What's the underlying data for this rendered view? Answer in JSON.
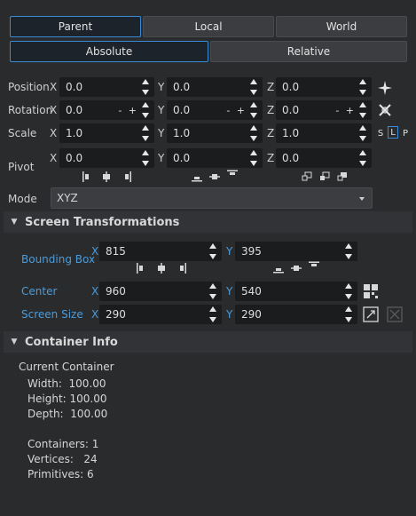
{
  "coord_tabs": [
    "Parent",
    "Local",
    "World"
  ],
  "mode_tabs": [
    "Absolute",
    "Relative"
  ],
  "rows": {
    "position": {
      "label": "Position",
      "x": "0.0",
      "y": "0.0",
      "z": "0.0"
    },
    "rotation": {
      "label": "Rotation",
      "x": "0.0",
      "y": "0.0",
      "z": "0.0"
    },
    "scale": {
      "label": "Scale",
      "x": "1.0",
      "y": "1.0",
      "z": "1.0",
      "toggles": [
        "S",
        "L",
        "P"
      ]
    },
    "pivot": {
      "label": "Pivot",
      "x": "0.0",
      "y": "0.0",
      "z": "0.0"
    }
  },
  "axes": {
    "x": "X",
    "y": "Y",
    "z": "Z"
  },
  "stepper": "- +",
  "mode": {
    "label": "Mode",
    "value": "XYZ"
  },
  "screen": {
    "title": "Screen Transformations",
    "bbox": {
      "label": "Bounding Box",
      "x": "815",
      "y": "395"
    },
    "center": {
      "label": "Center",
      "x": "960",
      "y": "540"
    },
    "size": {
      "label": "Screen Size",
      "x": "290",
      "y": "290"
    }
  },
  "container": {
    "title": "Container Info",
    "heading": "Current Container",
    "width": "Width:  100.00",
    "height": "Height: 100.00",
    "depth": "Depth:  100.00",
    "containers": "Containers: 1",
    "vertices": "Vertices:   24",
    "primitives": "Primitives: 6"
  }
}
